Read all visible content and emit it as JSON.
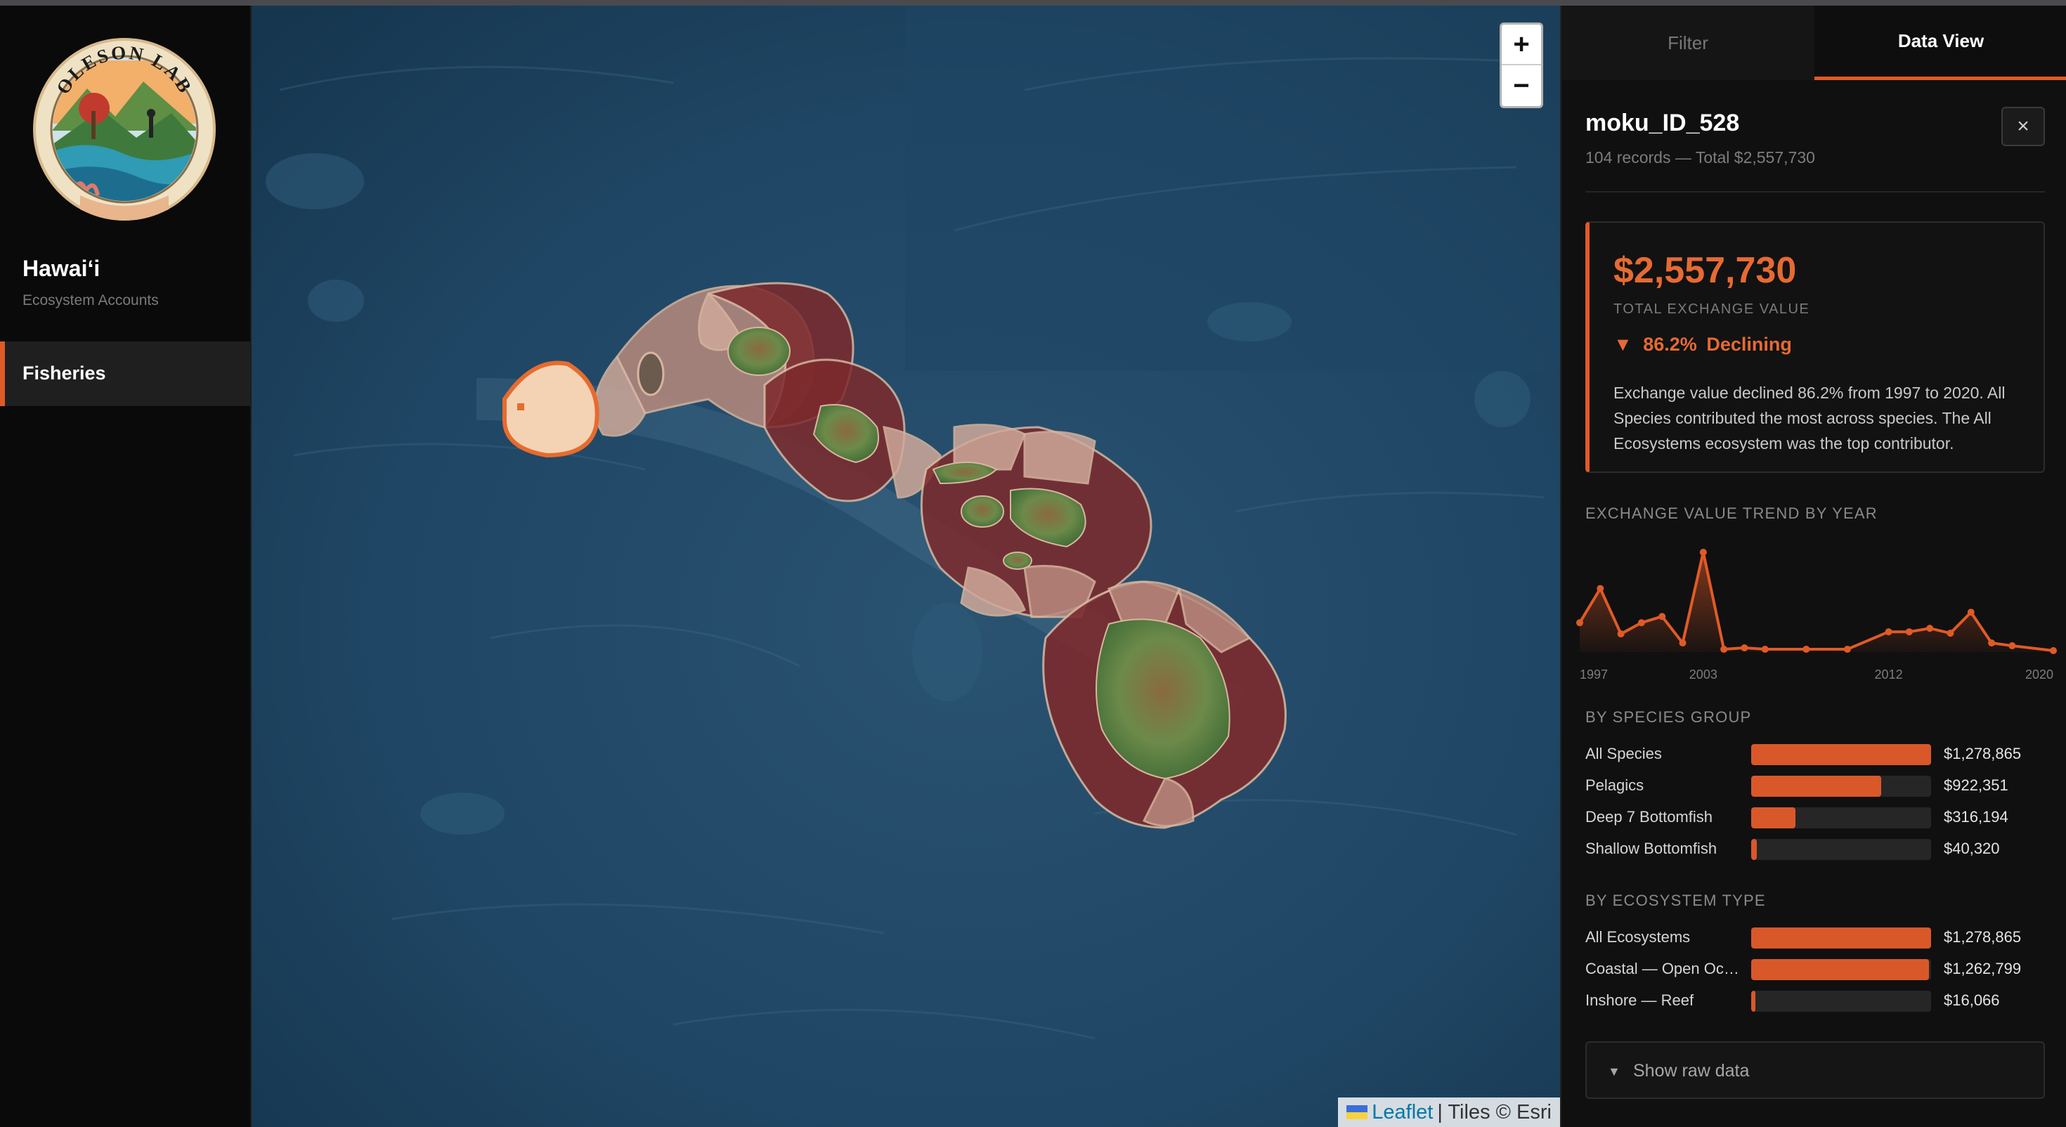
{
  "sidebar": {
    "logo_text": "OLESON LAB",
    "title": "Hawaiʻi",
    "subtitle": "Ecosystem Accounts",
    "nav": [
      {
        "label": "Fisheries",
        "active": true
      }
    ]
  },
  "map": {
    "zoom_in": "+",
    "zoom_out": "−",
    "attribution_link": "Leaflet",
    "attribution_text": "| Tiles © Esri"
  },
  "panel": {
    "tabs": [
      {
        "label": "Filter"
      },
      {
        "label": "Data View",
        "active": true
      }
    ],
    "title": "moku_ID_528",
    "subtitle": "104 records — Total $2,557,730",
    "close_icon": "×",
    "summary": {
      "value": "$2,557,730",
      "label": "TOTAL EXCHANGE VALUE",
      "trend_arrow": "▼",
      "trend_pct": "86.2%",
      "trend_word": "Declining",
      "text": "Exchange value declined 86.2% from 1997 to 2020. All Species contributed the most across species. The All Ecosystems ecosystem was the top contributor."
    },
    "trend_heading": "EXCHANGE VALUE TREND BY YEAR",
    "species_heading": "BY SPECIES GROUP",
    "species": [
      {
        "label": "All Species",
        "value": "$1,278,865",
        "fraction": 1.0
      },
      {
        "label": "Pelagics",
        "value": "$922,351",
        "fraction": 0.721
      },
      {
        "label": "Deep 7 Bottomfish",
        "value": "$316,194",
        "fraction": 0.247
      },
      {
        "label": "Shallow Bottomfish",
        "value": "$40,320",
        "fraction": 0.032
      }
    ],
    "ecosystem_heading": "BY ECOSYSTEM TYPE",
    "ecosystems": [
      {
        "label": "All Ecosystems",
        "value": "$1,278,865",
        "fraction": 1.0
      },
      {
        "label": "Coastal — Open Oc…",
        "value": "$1,262,799",
        "fraction": 0.987
      },
      {
        "label": "Inshore — Reef",
        "value": "$16,066",
        "fraction": 0.013
      }
    ],
    "raw_toggle_icon": "▼",
    "raw_toggle_label": "Show raw data"
  },
  "chart_data": {
    "type": "area",
    "x_tick_labels": [
      "1997",
      "2003",
      "2012",
      "2020"
    ],
    "x": [
      1997,
      1998,
      1999,
      2000,
      2001,
      2002,
      2003,
      2004,
      2005,
      2006,
      2008,
      2010,
      2012,
      2013,
      2014,
      2015,
      2016,
      2017,
      2018,
      2020
    ],
    "values": [
      0.42,
      0.91,
      0.26,
      0.42,
      0.51,
      0.13,
      1.43,
      0.04,
      0.06,
      0.04,
      0.04,
      0.04,
      0.29,
      0.29,
      0.34,
      0.27,
      0.57,
      0.13,
      0.09,
      0.02
    ],
    "color": "#e05a27",
    "grid": false
  },
  "colors": {
    "accent": "#e05a27",
    "background": "#0a0a0a",
    "ocean": "#1f4562"
  }
}
